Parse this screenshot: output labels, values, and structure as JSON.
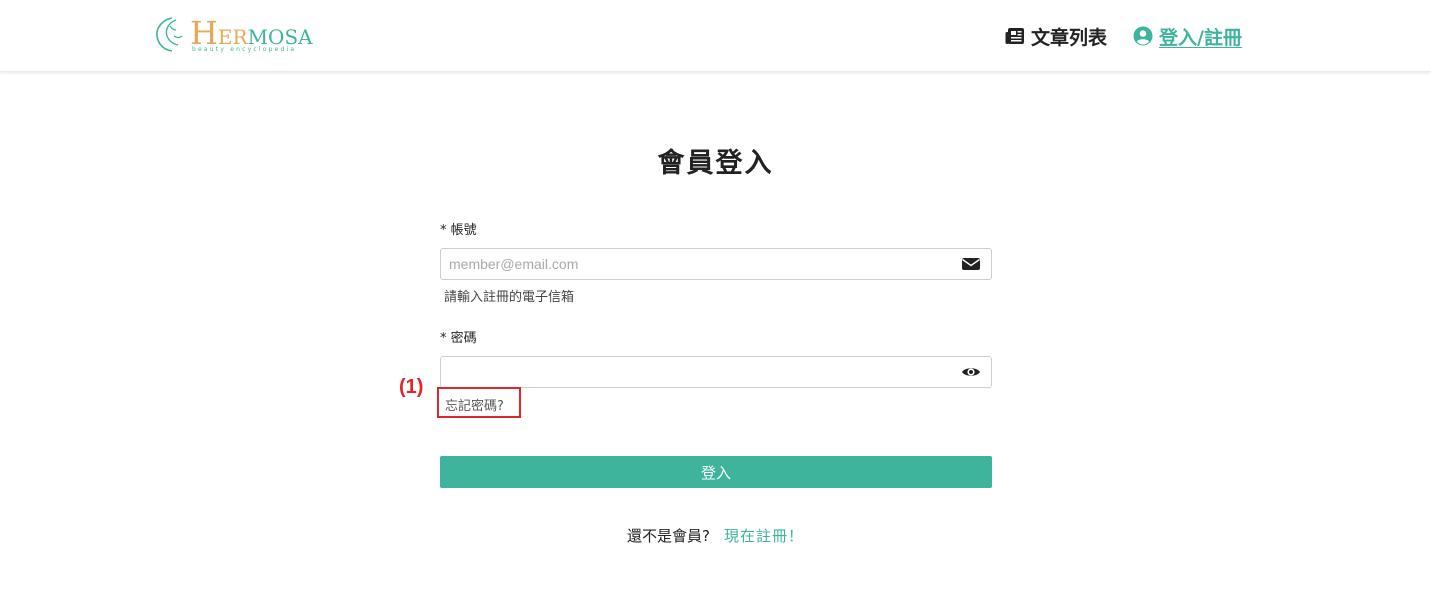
{
  "brand": {
    "logo_h": "H",
    "logo_er": "ER",
    "logo_mosa": "MOSA",
    "logo_tagline": "beauty encyclopedia",
    "primary_color": "#3db49b",
    "accent_color": "#e7a85a"
  },
  "nav": {
    "articles_label": "文章列表",
    "articles_icon": "newspaper-icon",
    "login_label": "登入/註冊",
    "login_icon": "user-circle-icon"
  },
  "page": {
    "title": "會員登入"
  },
  "form": {
    "account": {
      "label": "* 帳號",
      "placeholder": "member@email.com",
      "value": "",
      "help": "請輸入註冊的電子信箱",
      "icon": "envelope-icon"
    },
    "password": {
      "label": "* 密碼",
      "value": "",
      "icon": "eye-icon"
    },
    "forgot_label": "忘記密碼?",
    "submit_label": "登入"
  },
  "annotation": {
    "label": "(1)",
    "color": "#e0262a"
  },
  "register": {
    "question": "還不是會員?",
    "link_label": "現在註冊！"
  }
}
